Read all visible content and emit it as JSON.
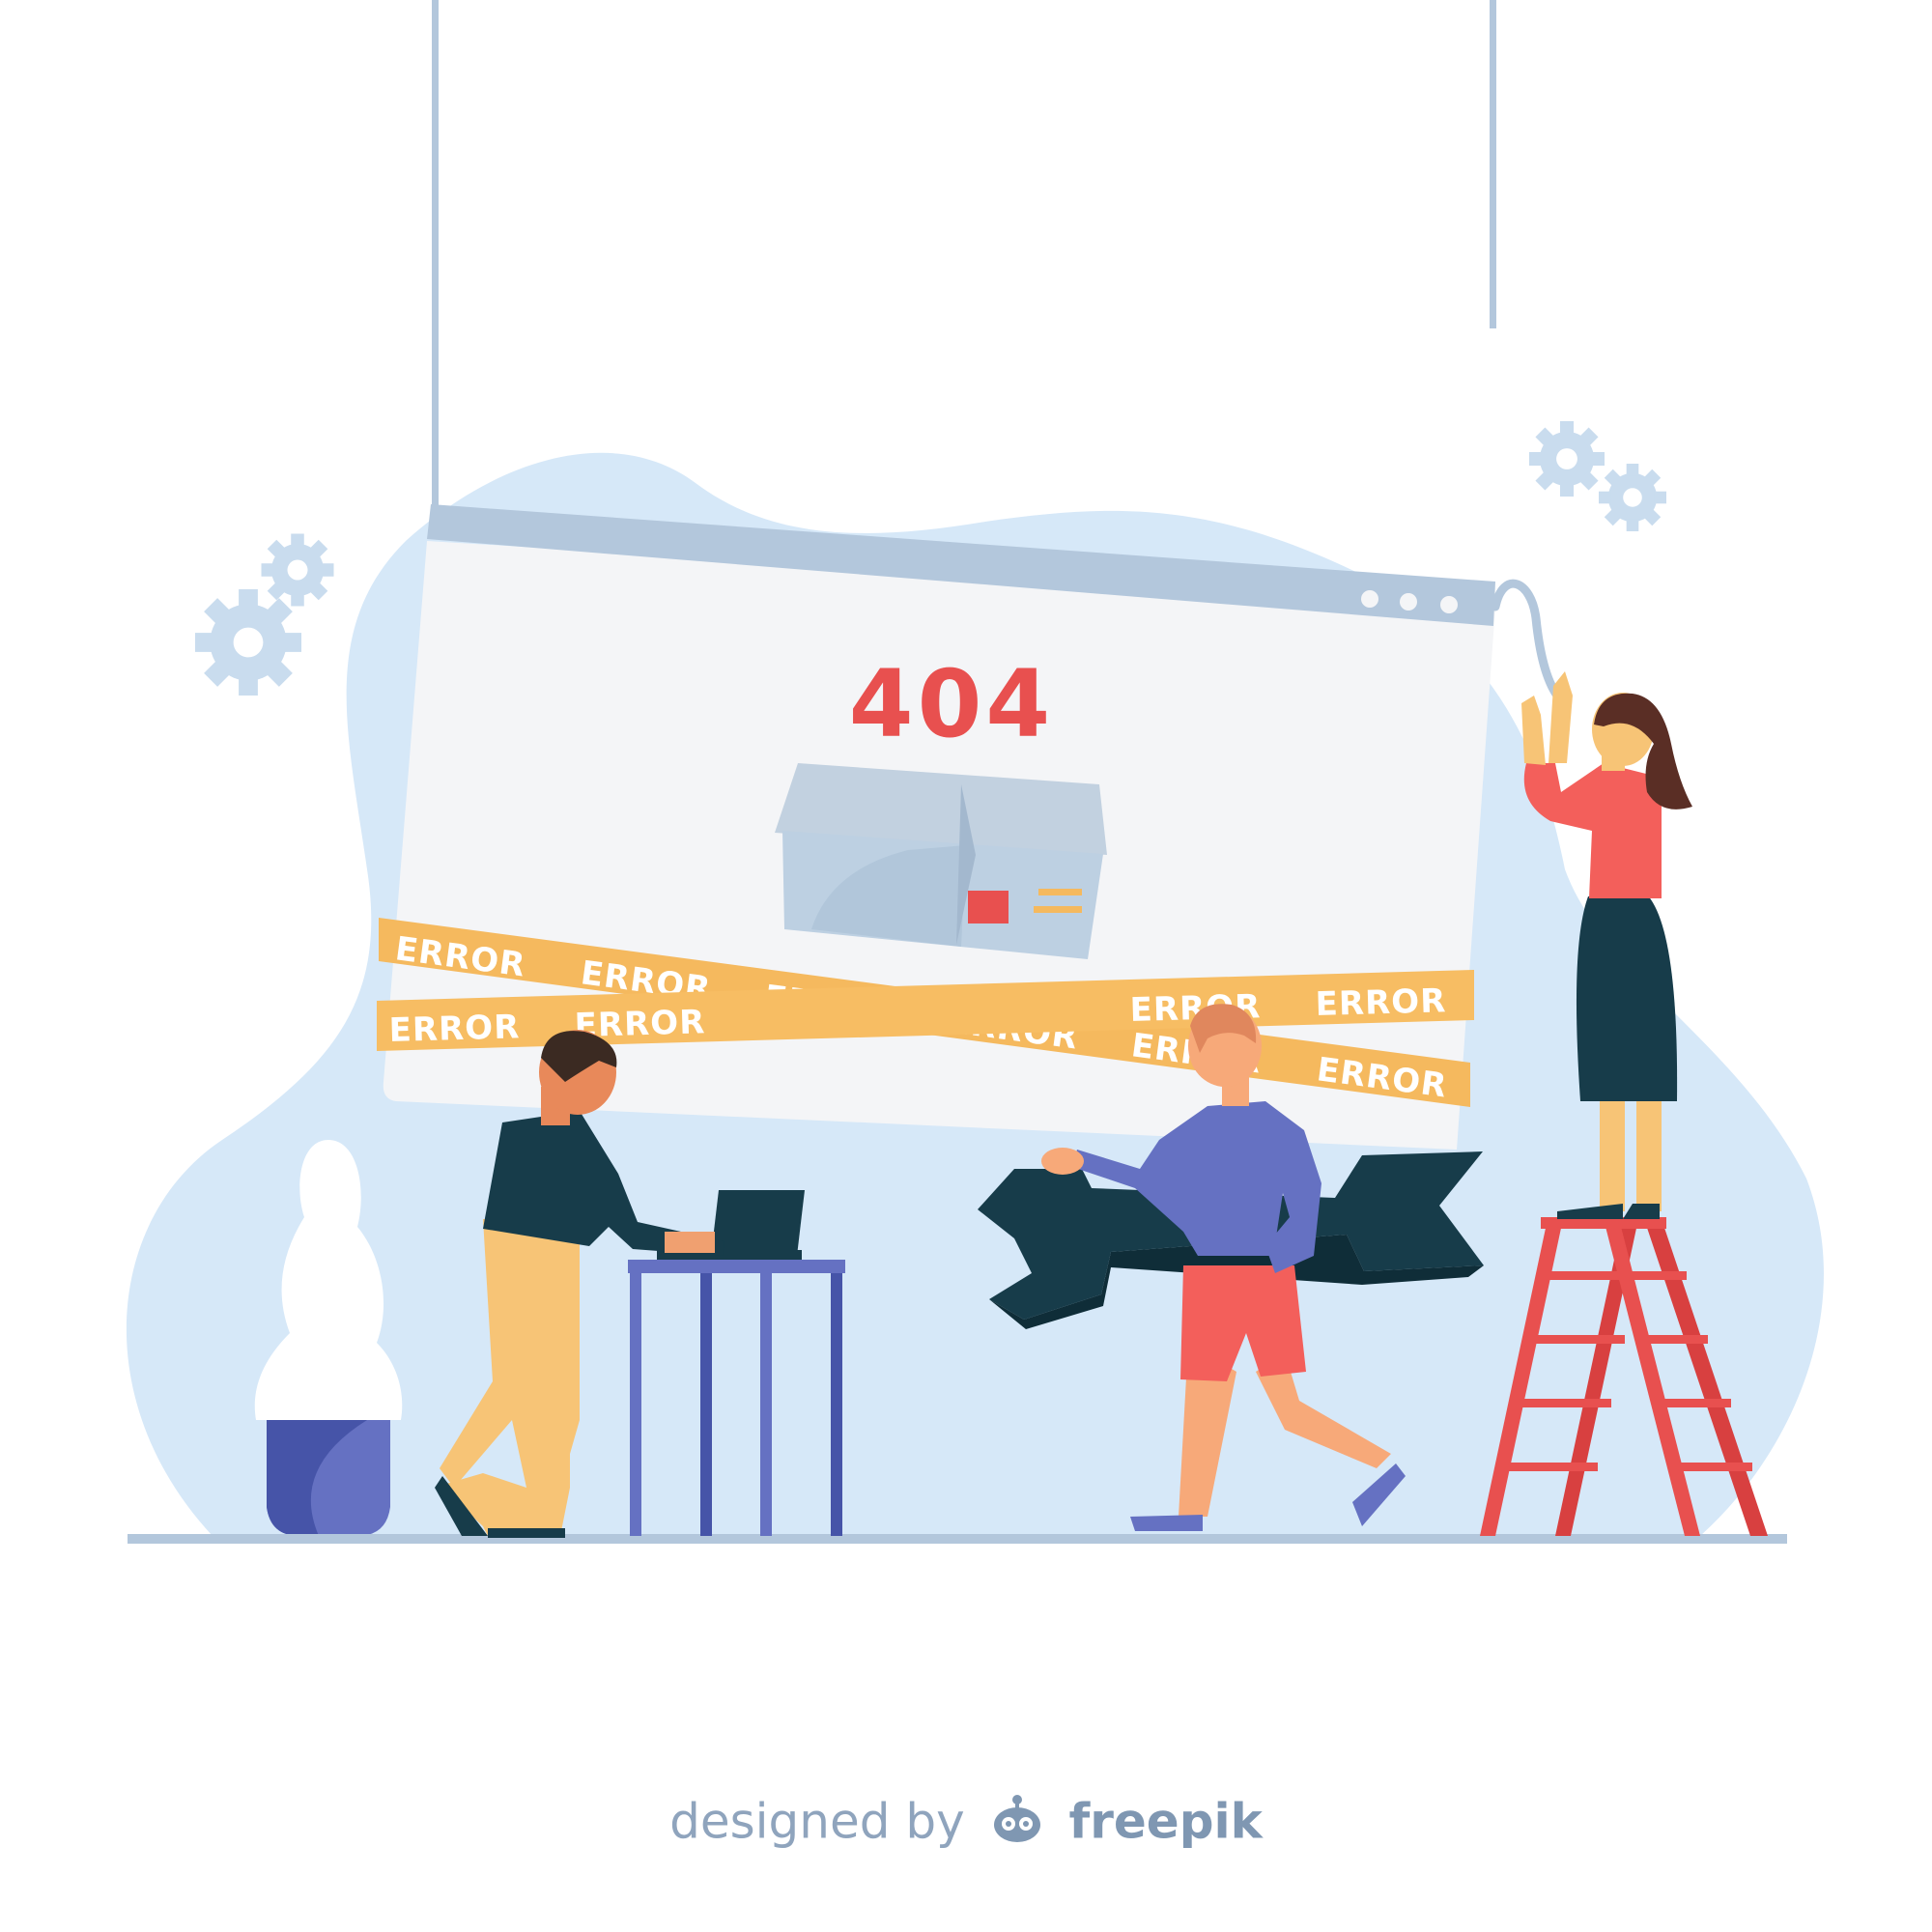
{
  "error_page": {
    "code": "404",
    "tape_label": "ERROR"
  },
  "credit": {
    "designed_by": "designed by",
    "brand": "freepik"
  },
  "colors": {
    "blob": "#d6e8f8",
    "screen": "#f4f5f7",
    "frame": "#b3c7dc",
    "accent_red": "#e8504f",
    "tape": "#f5b95e",
    "navy": "#173c4a",
    "violet": "#6571c2",
    "gear": "#c9dcee"
  },
  "icons": [
    "gear-icon",
    "wrench-icon",
    "box-icon",
    "freepik-logo-icon"
  ]
}
